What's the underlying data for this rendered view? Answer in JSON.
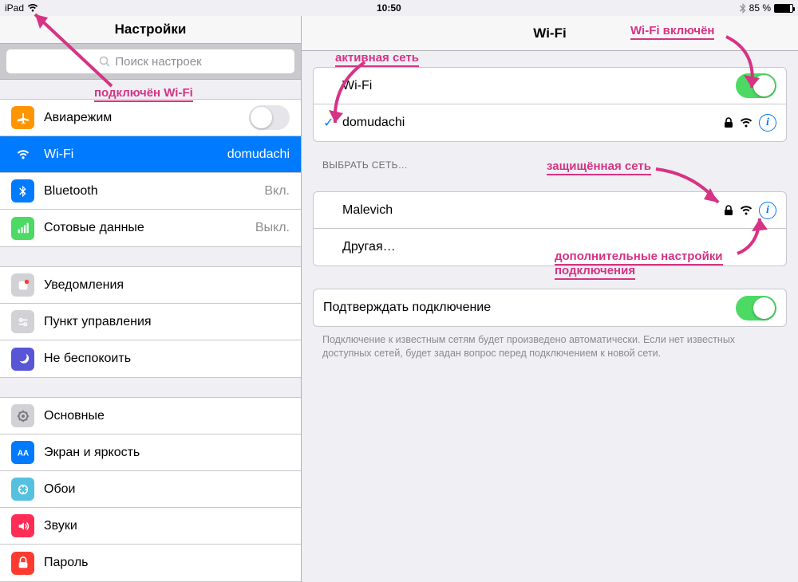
{
  "statusbar": {
    "device": "iPad",
    "time": "10:50",
    "battery_pct": "85 %"
  },
  "sidebar": {
    "title": "Настройки",
    "search_placeholder": "Поиск настроек",
    "groups": [
      [
        {
          "label": "Авиарежим",
          "kind": "toggle",
          "on": false,
          "icon": "airplane",
          "bg": "#ff9500"
        },
        {
          "label": "Wi-Fi",
          "value": "domudachi",
          "active": true,
          "icon": "wifi",
          "bg": "#007aff"
        },
        {
          "label": "Bluetooth",
          "value": "Вкл.",
          "icon": "bluetooth",
          "bg": "#007aff"
        },
        {
          "label": "Сотовые данные",
          "value": "Выкл.",
          "icon": "cellular",
          "bg": "#4cd964"
        }
      ],
      [
        {
          "label": "Уведомления",
          "icon": "notify",
          "bg": "#d1d1d6"
        },
        {
          "label": "Пункт управления",
          "icon": "control",
          "bg": "#d1d1d6"
        },
        {
          "label": "Не беспокоить",
          "icon": "dnd",
          "bg": "#5856d6"
        }
      ],
      [
        {
          "label": "Основные",
          "icon": "general",
          "bg": "#d1d1d6"
        },
        {
          "label": "Экран и яркость",
          "icon": "display",
          "bg": "#007aff"
        },
        {
          "label": "Обои",
          "icon": "wallpaper",
          "bg": "#55c1df"
        },
        {
          "label": "Звуки",
          "icon": "sounds",
          "bg": "#ff2d55"
        },
        {
          "label": "Пароль",
          "icon": "passcode",
          "bg": "#ff3b30"
        }
      ]
    ]
  },
  "detail": {
    "title": "Wi-Fi",
    "wifi_label": "Wi-Fi",
    "wifi_on": true,
    "connected": {
      "name": "domudachi",
      "locked": true
    },
    "choose_header": "ВЫБРАТЬ СЕТЬ…",
    "networks": [
      {
        "name": "Malevich",
        "locked": true
      }
    ],
    "other_label": "Другая…",
    "ask": {
      "label": "Подтверждать подключение",
      "on": true
    },
    "footer": "Подключение к известным сетям будет произведено автоматически. Если нет известных доступных сетей, будет задан вопрос перед подключением к новой сети."
  },
  "anno": {
    "a1": "подключён Wi-Fi",
    "a2": "активная сеть",
    "a3": "Wi-Fi включён",
    "a4": "защищённая сеть",
    "a5_line1": "дополнительные настройки",
    "a5_line2": "подключения"
  }
}
